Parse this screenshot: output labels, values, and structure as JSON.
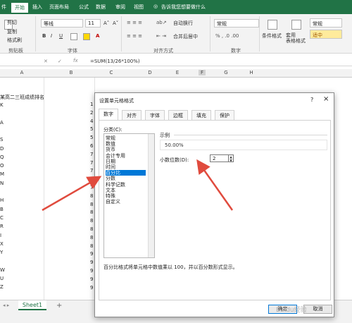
{
  "colors": {
    "brand": "#217346",
    "selection": "#0078d7",
    "arrow": "#e04b3e"
  },
  "ribbon_tabs": [
    "件",
    "开始",
    "插入",
    "页面布局",
    "公式",
    "数据",
    "审阅",
    "视图"
  ],
  "tell_me": "告诉我您想要做什么",
  "clipboard": {
    "cut": "剪切",
    "copy": "复制",
    "painter": "格式刷",
    "label": "剪贴板"
  },
  "font": {
    "name": "等线",
    "size": "11",
    "label": "字体",
    "bold": "B",
    "italic": "I",
    "underline": "U"
  },
  "alignment": {
    "wrap": "自动换行",
    "merge": "合并后居中",
    "label": "对齐方式"
  },
  "number": {
    "format": "常规",
    "label": "数字"
  },
  "styles": {
    "conditional": "条件格式",
    "table": "套用\n表格格式",
    "normal": "常规",
    "neutral": "适中"
  },
  "formula_bar": {
    "formula": "=SUM(13/26*100%)"
  },
  "columns": [
    "A",
    "B",
    "C",
    "D",
    "E",
    "F",
    "G",
    "H"
  ],
  "sheet": {
    "title_cell": "某高二三班成绩排名",
    "col_a": [
      "K",
      "",
      "A",
      "",
      "S",
      "D",
      "Q",
      "O",
      "M",
      "N",
      "",
      "H",
      "B",
      "C",
      "R",
      "I",
      "X",
      "Y",
      "",
      "W",
      "U",
      "Z"
    ],
    "col_b": [
      "1",
      "2",
      "4",
      "5",
      "5",
      "6",
      "7",
      "7",
      "7",
      "7",
      "7",
      "8",
      "8",
      "8",
      "8",
      "8",
      "8",
      "8",
      "9",
      "9",
      "9",
      "9",
      "9"
    ],
    "sheet_tab": "Sheet1",
    "add_sheet": "+"
  },
  "dialog": {
    "title": "设置单元格格式",
    "help": "?",
    "close": "×",
    "tabs": [
      "数字",
      "对齐",
      "字体",
      "边框",
      "填充",
      "保护"
    ],
    "category_label": "分类(C):",
    "categories": [
      "常规",
      "数值",
      "货币",
      "会计专用",
      "日期",
      "时间",
      "百分比",
      "分数",
      "科学记数",
      "文本",
      "特殊",
      "自定义"
    ],
    "selected_category": "百分比",
    "sample_label": "示例",
    "sample_value": "50.00%",
    "decimal_label": "小数位数(D):",
    "decimal_value": "2",
    "description": "百分比格式将单元格中数值乘以 100，并以百分数形式显示。",
    "ok": "确定",
    "cancel": "取消"
  },
  "watermark": "Baidu经验"
}
